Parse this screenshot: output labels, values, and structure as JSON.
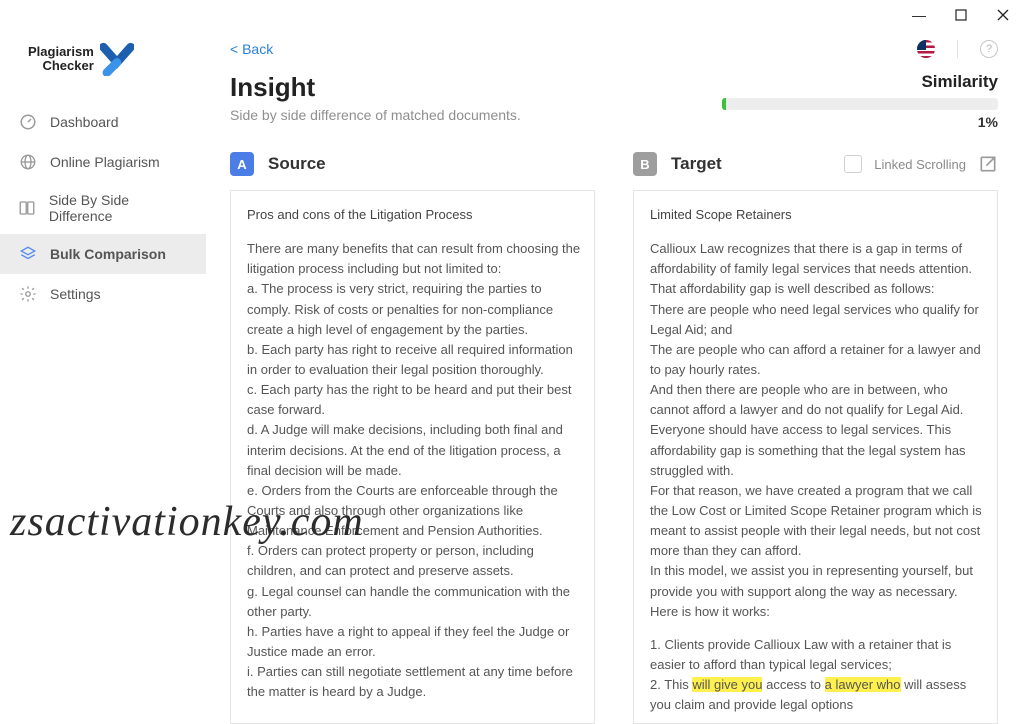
{
  "window": {
    "minimize": "—",
    "maximize": "▢",
    "close": "✕"
  },
  "logo": {
    "line1": "Plagiarism",
    "line2": "Checker"
  },
  "nav": {
    "dashboard": "Dashboard",
    "online": "Online Plagiarism",
    "sidebyside": "Side By Side Difference",
    "bulk": "Bulk Comparison",
    "settings": "Settings"
  },
  "back": "<  Back",
  "title": "Insight",
  "subtitle": "Side by side difference of matched documents.",
  "similarity": {
    "label": "Similarity",
    "value": "1%"
  },
  "panelA": {
    "badge": "A",
    "title": "Source"
  },
  "panelB": {
    "badge": "B",
    "title": "Target",
    "linked": "Linked Scrolling"
  },
  "source": {
    "heading": "Pros and cons of the Litigation Process",
    "intro": "There are many benefits that can result from choosing the litigation process including but not limited to:",
    "a": "a.           The process is very strict, requiring the parties to comply.  Risk of costs or penalties for non-compliance create a high level of engagement by the parties.",
    "b": "b.           Each party has right to receive all required information in order to evaluation their legal position thoroughly.",
    "c": "c.           Each party has the right to be heard and put their best case forward.",
    "d": "d.           A Judge will make decisions, including both final and interim decisions.  At the end of the litigation process, a final decision will be made.",
    "e": "e.           Orders from the Courts are enforceable through the Courts and also through other organizations like Maintenance Enforcement and Pension Authorities.",
    "f": "f.            Orders can protect property or person, including children, and can protect and preserve assets.",
    "g": "g.           Legal counsel can handle the communication with the other party.",
    "h": "h.           Parties have a right to appeal if they feel the Judge or Justice made an error.",
    "i": "i.            Parties can still negotiate settlement at any time before the matter is heard by a Judge."
  },
  "target": {
    "heading": "Limited Scope Retainers",
    "p1": "Callioux Law recognizes that there is a gap in terms of affordability of family legal services that needs attention.  That affordability gap is well described as follows:",
    "p2": "There are people who need legal services who qualify for Legal Aid; and",
    "p3": "The are people who can afford a retainer for a lawyer and to pay hourly rates.",
    "p4": "And then there are people who are in between, who cannot afford a lawyer and do not qualify for Legal Aid.  Everyone should have access to legal services.   This affordability gap is something that the legal system has struggled with.",
    "p5": "For that reason, we have created a program that we call the Low Cost or Limited Scope Retainer program which is meant to assist people with their legal needs, but not cost more than they can afford.",
    "p6": "In this model, we assist you in representing yourself, but provide you with support along the way as necessary. Here is how it works:",
    "l1": "1.            Clients provide Callioux Law with a retainer that is easier to afford than typical legal services;",
    "l2a": "2.            This ",
    "l2h1": "will give you",
    "l2b": " access to ",
    "l2h2": "a lawyer who",
    "l2c": " will assess you claim and provide legal options"
  },
  "watermark": "zsactivationkey.com"
}
